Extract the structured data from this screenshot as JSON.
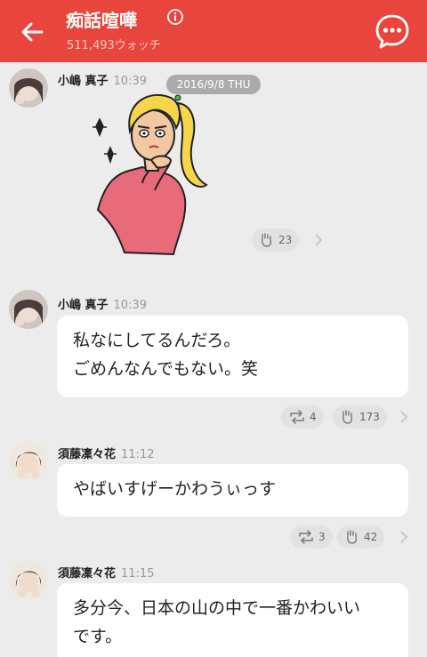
{
  "header": {
    "title": "痴話喧嘩",
    "watch_count": "511,493ウォッチ",
    "colors": {
      "brand": "#e8453c"
    },
    "icons": [
      "back-arrow-icon",
      "info-icon",
      "menu-dots-icon"
    ]
  },
  "date_badge": "2016/9/8 THU",
  "messages": [
    {
      "sender": "小嶋 真子",
      "time": "10:39",
      "type": "sticker",
      "sticker": "blonde-woman-thinking-sticker",
      "applause": "23"
    },
    {
      "sender": "小嶋 真子",
      "time": "10:39",
      "type": "text",
      "lines": [
        "私なにしてるんだろ。",
        "ごめんなんでもない。笑"
      ],
      "retweets": "4",
      "applause": "173"
    },
    {
      "sender": "須藤凜々花",
      "time": "11:12",
      "type": "text",
      "lines": [
        "やばいすげーかわうぃっす"
      ],
      "retweets": "3",
      "applause": "42"
    },
    {
      "sender": "須藤凜々花",
      "time": "11:15",
      "type": "text",
      "lines": [
        "多分今、日本の山の中で一番かわいい",
        "です。"
      ]
    }
  ]
}
